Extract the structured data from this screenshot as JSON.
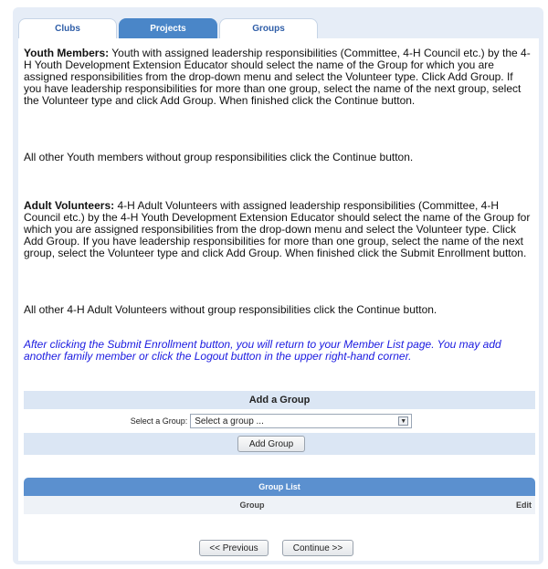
{
  "tabs": [
    {
      "label": "Clubs"
    },
    {
      "label": "Projects"
    },
    {
      "label": "Groups"
    }
  ],
  "youth": {
    "heading": "Youth Members:",
    "text": " Youth with assigned leadership responsibilities (Committee, 4-H Council etc.) by the 4-H Youth Development Extension Educator should select the name of the Group for which you are assigned responsibilities from the drop-down menu and select the Volunteer type. Click Add Group. If you have leadership responsibilities for more than one group, select the name of the next group, select the Volunteer type and click Add Group. When finished click the Continue button.",
    "other": "All other Youth members without group responsibilities click the Continue button."
  },
  "adult": {
    "heading": "Adult Volunteers:",
    "text": " 4-H Adult Volunteers with assigned leadership responsibilities (Committee, 4-H Council etc.) by the 4-H Youth Development Extension Educator should select the name of the Group for which you are assigned responsibilities from the drop-down menu and select the Volunteer type. Click Add Group. If you have leadership responsibilities for more than one group, select the name of the next group, select the Volunteer type and click Add Group. When finished click the Submit Enrollment button.",
    "other": "All other 4-H Adult Volunteers without group responsibilities click the Continue button."
  },
  "note": "After clicking the Submit Enrollment button, you will return to your Member List page. You may add another family member or click the Logout button in the upper right-hand corner.",
  "add_group": {
    "title": "Add a Group",
    "select_label": "Select a Group:",
    "select_value": "Select a group ...",
    "button": "Add Group"
  },
  "group_list": {
    "title": "Group List",
    "col_group": "Group",
    "col_edit": "Edit"
  },
  "nav": {
    "previous": "<< Previous",
    "continue": "Continue >>"
  },
  "colors": {
    "tab_active": "#4a86c8",
    "list_header": "#5b90cf",
    "note": "#1a1ae0",
    "panel_bg": "#e6edf7"
  }
}
